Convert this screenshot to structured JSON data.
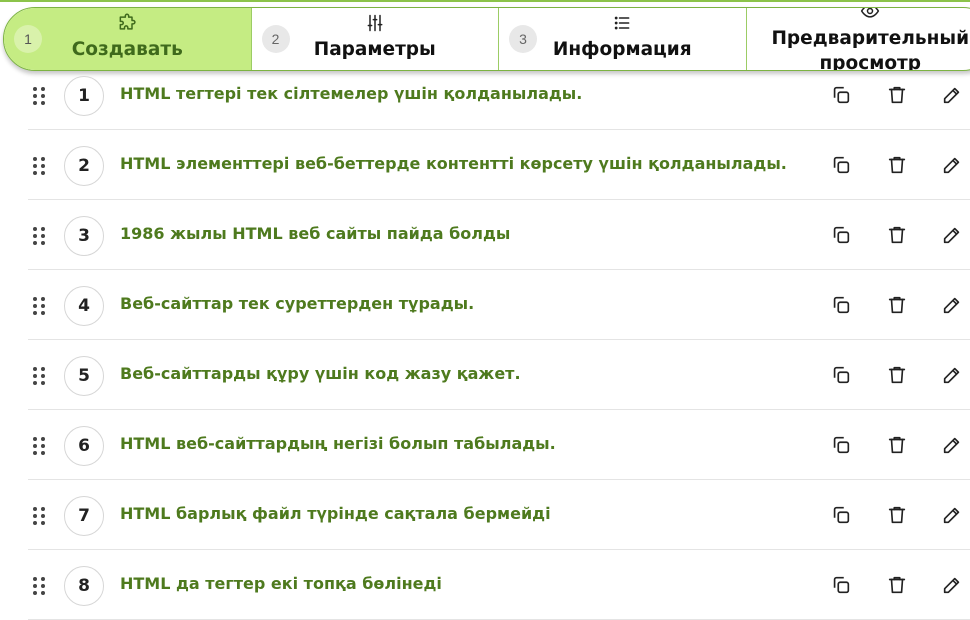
{
  "steps": [
    {
      "num": "1",
      "label": "Создавать",
      "icon": "puzzle-icon",
      "active": true
    },
    {
      "num": "2",
      "label": "Параметры",
      "icon": "sliders-icon",
      "active": false
    },
    {
      "num": "3",
      "label": "Информация",
      "icon": "list-icon",
      "active": false
    },
    {
      "num": "",
      "label": "Предварительный просмотр",
      "icon": "eye-icon",
      "active": false
    }
  ],
  "questions": [
    {
      "num": "1",
      "text": "HTML тегтері тек сілтемелер үшін қолданылады."
    },
    {
      "num": "2",
      "text": "HTML элементтері веб-беттерде контентті көрсету үшін қолданылады."
    },
    {
      "num": "3",
      "text": "1986 жылы HTML веб сайты пайда болды"
    },
    {
      "num": "4",
      "text": "Веб-сайттар тек суреттерден тұрады."
    },
    {
      "num": "5",
      "text": "Веб-сайттарды құру үшін код жазу қажет."
    },
    {
      "num": "6",
      "text": "HTML веб-сайттардың негізі болып табылады."
    },
    {
      "num": "7",
      "text": "HTML барлық файл түрінде сақтала бермейді"
    },
    {
      "num": "8",
      "text": "HTML да тегтер екі топқа бөлінеді"
    }
  ],
  "row_actions": [
    "copy-icon",
    "trash-icon",
    "pencil-icon"
  ],
  "colors": {
    "accent": "#c5ec83",
    "text_green": "#4e7a1e",
    "border_green": "#7cb342"
  }
}
